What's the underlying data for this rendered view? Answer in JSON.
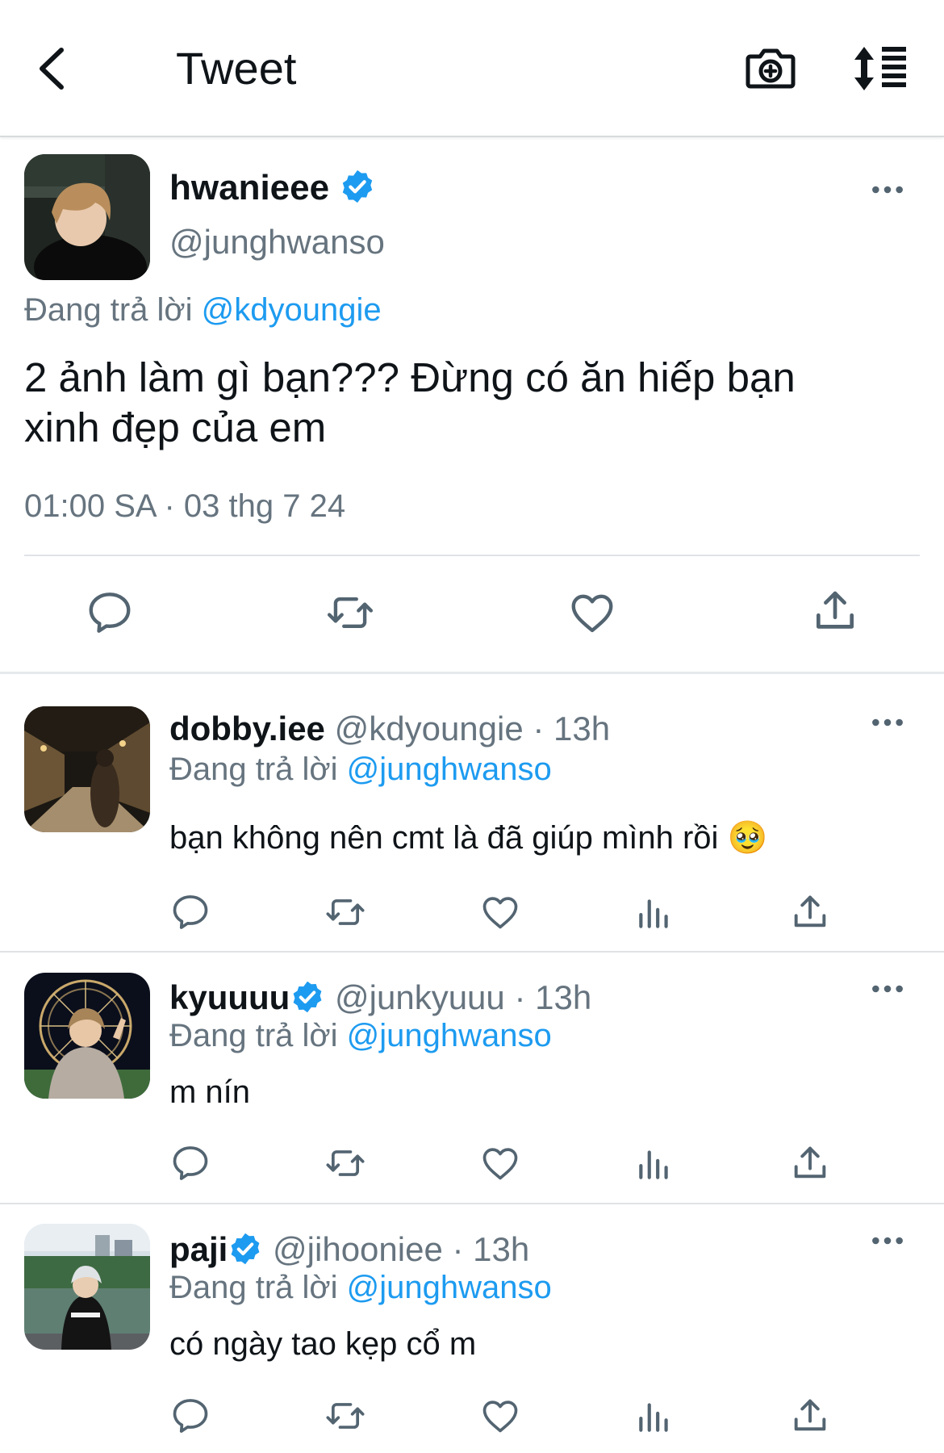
{
  "header": {
    "title": "Tweet"
  },
  "main_tweet": {
    "display_name": "hwanieee",
    "handle": "@junghwanso",
    "replying_prefix": "Đang trả lời",
    "replying_to": "@kdyoungie",
    "text_line1": "2 ảnh làm gì bạn??? Đừng có ăn hiếp bạn",
    "text_line2": "xinh đẹp của em",
    "timestamp": "01:00 SA · 03 thg 7 24"
  },
  "replies": [
    {
      "display_name": "dobby.iee",
      "handle": "@kdyoungie",
      "time": "· 13h",
      "verified": false,
      "replying_prefix": "Đang trả lời",
      "replying_to": "@junghwanso",
      "text": "bạn không nên cmt là đã giúp mình rồi",
      "emoji": "🥹"
    },
    {
      "display_name": "kyuuuu",
      "handle": "@junkyuuu",
      "time": "· 13h",
      "verified": true,
      "replying_prefix": "Đang trả lời",
      "replying_to": "@junghwanso",
      "text": "m nín"
    },
    {
      "display_name": "paji",
      "handle": "@jihooniee",
      "time": "· 13h",
      "verified": true,
      "replying_prefix": "Đang trả lời",
      "replying_to": "@junghwanso",
      "text": "có ngày tao kẹp cổ m"
    }
  ],
  "icons": {
    "back": "chevron-left-icon",
    "camera": "camera-plus-icon",
    "sort": "sort-icon",
    "reply": "comment-icon",
    "retweet": "retweet-icon",
    "like": "heart-icon",
    "views": "bar-chart-icon",
    "share": "share-icon",
    "more": "more-icon"
  },
  "colors": {
    "link": "#1d9bf0",
    "muted": "#66747f",
    "icon": "#536471",
    "divider": "#dfe3e6"
  }
}
